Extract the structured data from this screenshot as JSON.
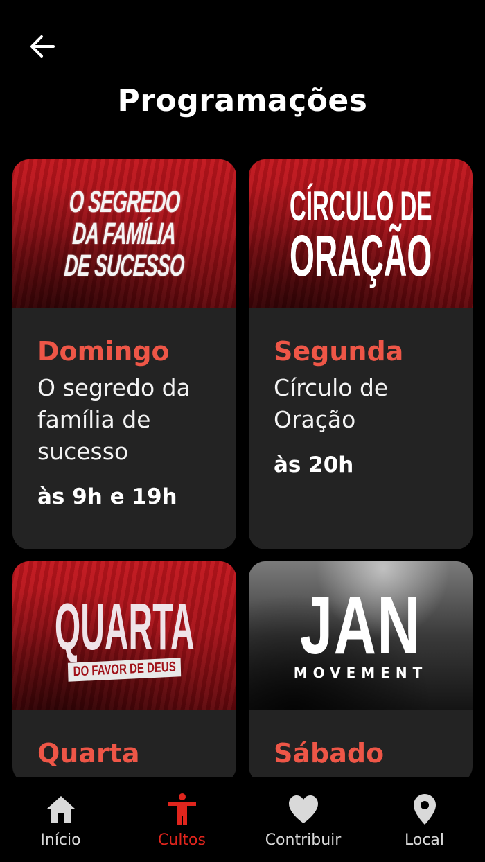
{
  "header": {
    "title": "Programações"
  },
  "cards": [
    {
      "banner_lines": [
        "O SEGREDO",
        "DA FAMÍLIA",
        "DE SUCESSO"
      ],
      "day": "Domingo",
      "description": "O segredo da família de sucesso",
      "time": "às 9h e 19h"
    },
    {
      "banner_lines": [
        "CÍRCULO DE",
        "ORAÇÃO"
      ],
      "day": "Segunda",
      "description": "Círculo de Oração",
      "time": "às 20h"
    },
    {
      "banner_lines": [
        "QUARTA",
        "DO FAVOR DE DEUS"
      ],
      "day": "Quarta"
    },
    {
      "banner_lines": [
        "JAN",
        "MOVEMENT"
      ],
      "day": "Sábado"
    }
  ],
  "nav": [
    {
      "label": "Início",
      "icon": "home-icon"
    },
    {
      "label": "Cultos",
      "icon": "person-icon",
      "active": true
    },
    {
      "label": "Contribuir",
      "icon": "heart-icon"
    },
    {
      "label": "Local",
      "icon": "location-pin-icon"
    }
  ],
  "colors": {
    "background": "#000000",
    "card": "#232323",
    "accent": "#ee5647",
    "active_nav": "#e0251d"
  }
}
